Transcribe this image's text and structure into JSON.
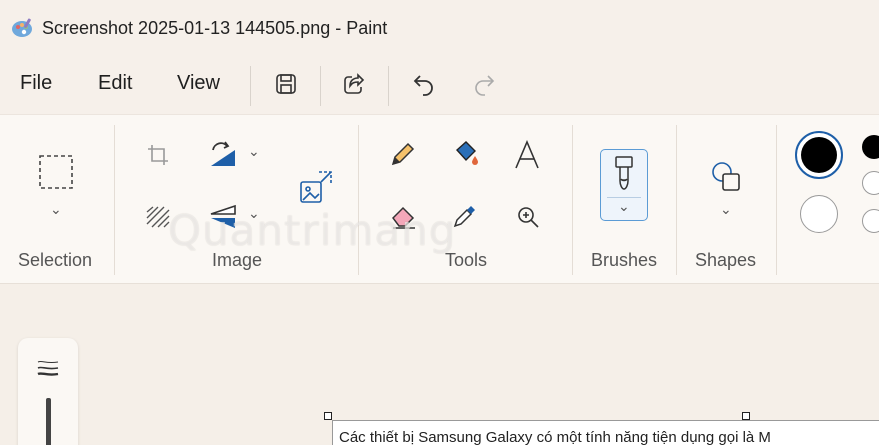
{
  "window": {
    "title": "Screenshot 2025-01-13 144505.png - Paint"
  },
  "menubar": {
    "items": [
      "File",
      "Edit",
      "View"
    ]
  },
  "ribbon": {
    "groups": {
      "selection": "Selection",
      "image": "Image",
      "tools": "Tools",
      "brushes": "Brushes",
      "shapes": "Shapes"
    }
  },
  "colors": {
    "primary": "#000000",
    "secondary": "#ffffff",
    "accent": "#5b9bd5"
  },
  "watermark": "Quantrimang",
  "canvas": {
    "text": "Các thiết bị Samsung Galaxy có một tính năng tiện dụng gọi là M"
  }
}
